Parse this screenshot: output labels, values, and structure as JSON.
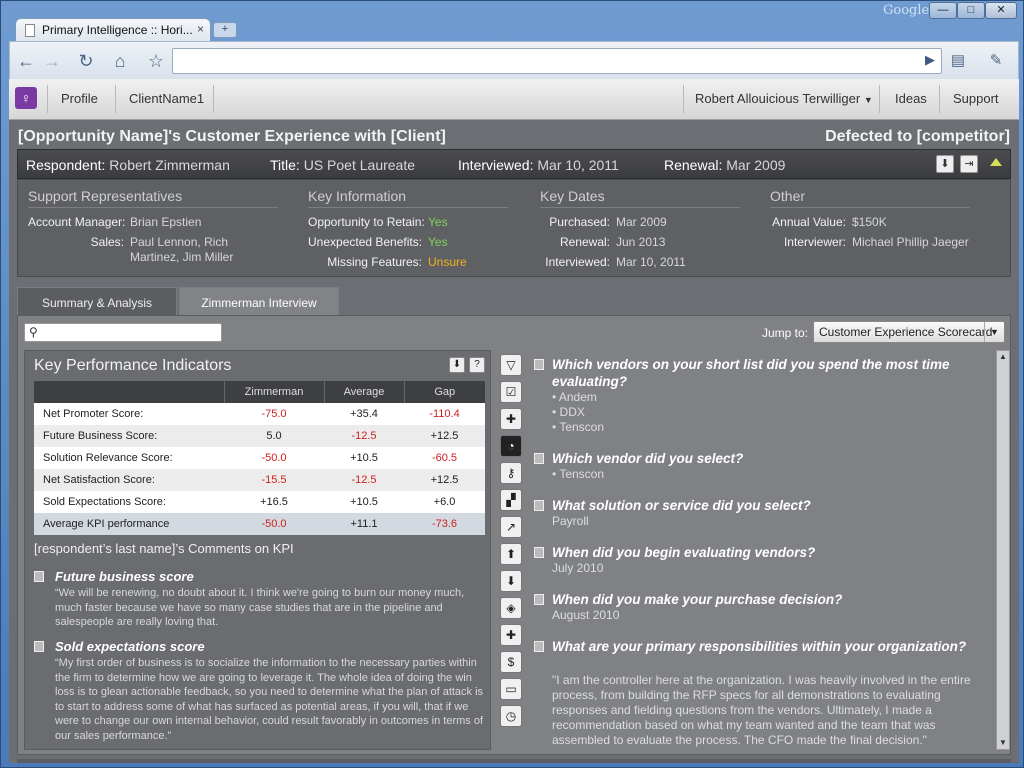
{
  "browser": {
    "tab_title": "Primary Intelligence :: Hori...",
    "tab_close": "×",
    "new_tab": "+",
    "brand": "Google",
    "minimize": "—",
    "maximize": "□",
    "close": "✕",
    "url": ""
  },
  "appnav": {
    "logo": "♀",
    "profile": "Profile",
    "client": "ClientName1",
    "user": "Robert Allouicious Terwilliger",
    "ideas": "Ideas",
    "support": "Support"
  },
  "header": {
    "title": "[Opportunity Name]'s Customer Experience with [Client]",
    "status": "Defected to [competitor]"
  },
  "respondent": {
    "name_label": "Respondent:",
    "name": "Robert Zimmerman",
    "title_label": "Title:",
    "title": "US Poet Laureate",
    "interviewed_label": "Interviewed:",
    "interviewed": "Mar 10, 2011",
    "renewal_label": "Renewal:",
    "renewal": "Mar 2009"
  },
  "info": {
    "support": {
      "heading": "Support Representatives",
      "rows": [
        {
          "k": "Account Manager:",
          "v": "Brian Epstien"
        },
        {
          "k": "Sales:",
          "v": "Paul Lennon, Rich"
        },
        {
          "k": "",
          "v": "Martinez, Jim Miller"
        }
      ]
    },
    "key": {
      "heading": "Key Information",
      "rows": [
        {
          "k": "Opportunity to Retain:",
          "v": "Yes"
        },
        {
          "k": "Unexpected Benefits:",
          "v": "Yes"
        },
        {
          "k": "Missing Features:",
          "v": "Unsure"
        }
      ]
    },
    "dates": {
      "heading": "Key Dates",
      "rows": [
        {
          "k": "Purchased:",
          "v": "Mar 2009"
        },
        {
          "k": "Renewal:",
          "v": "Jun  2013"
        },
        {
          "k": "Interviewed:",
          "v": "Mar 10, 2011"
        }
      ]
    },
    "other": {
      "heading": "Other",
      "rows": [
        {
          "k": "Annual Value:",
          "v": "$150K"
        },
        {
          "k": "Interviewer:",
          "v": "Michael Phillip Jaeger"
        }
      ]
    }
  },
  "tabs": {
    "summary": "Summary & Analysis",
    "interview": "Zimmerman Interview"
  },
  "toolbar": {
    "search_placeholder": "",
    "jump_label": "Jump to:",
    "jump_value": "Customer Experience Scorecard"
  },
  "kpi": {
    "title": "Key Performance Indicators",
    "download": "⬇",
    "help": "?",
    "headers": [
      "",
      "Zimmerman",
      "Average",
      "Gap"
    ],
    "rows": [
      [
        "Net Promoter Score:",
        "-75.0",
        "+35.4",
        "-110.4"
      ],
      [
        "Future Business Score:",
        "5.0",
        "-12.5",
        "+12.5"
      ],
      [
        "Solution Relevance Score:",
        "-50.0",
        "+10.5",
        "-60.5"
      ],
      [
        "Net Satisfaction Score:",
        "-15.5",
        "-12.5",
        "+12.5"
      ],
      [
        "Sold Expectations Score:",
        "+16.5",
        "+10.5",
        "+6.0"
      ],
      [
        "Average KPI performance",
        "-50.0",
        "+11.1",
        "-73.6"
      ]
    ],
    "comments_heading": "[respondent’s last name]’s Comments on KPI",
    "comments": [
      {
        "title": "Future business score",
        "text": "“We will be renewing, no doubt about it. I think we're going to burn our money much, much faster because we have so many case studies that are in the pipeline and salespeople are really loving that."
      },
      {
        "title": "Sold expectations score",
        "text": "“My first order of business is to socialize the information to the necessary parties within the firm to determine how we are going to leverage it. The whole idea of doing the win loss is to glean actionable feedback, so you need to determine what the plan of attack is to start to address some of what has surfaced as potential areas, if you will, that if we were to change our own internal behavior, could result favorably in outcomes in terms of our sales performance.”"
      }
    ]
  },
  "tools": [
    "▽",
    "☑",
    "✚",
    "◔",
    "⚷",
    "▞",
    "↗",
    "⬆",
    "⬇",
    "◈",
    "✚",
    "$",
    "▭",
    "◷"
  ],
  "interview": {
    "questions": [
      {
        "q": "Which vendors on your short list did you spend the most time evaluating?",
        "a": [
          "• Andem",
          "• DDX",
          "• Tenscon"
        ]
      },
      {
        "q": "Which vendor did you select?",
        "a": [
          "• Tenscon"
        ]
      },
      {
        "q": "What solution or service did you select?",
        "a": [
          "Payroll"
        ]
      },
      {
        "q": "When did you begin evaluating vendors?",
        "a": [
          "July 2010"
        ]
      },
      {
        "q": "When did you make your purchase decision?",
        "a": [
          "August 2010"
        ]
      },
      {
        "q": "What are your primary responsibilities within your organization?",
        "a": [
          "\"I am the controller here at the organization. I was heavily involved in the entire process, from building the RFP specs for all demonstrations to evaluating responses and fielding questions from the vendors. Ultimately, I made a recommendation based on what my team wanted and the team that was assembled to evaluate the process. The CFO made the final decision.\""
        ]
      }
    ]
  },
  "colors": {
    "negative": "#cc1f1f",
    "positive_flag": "#7fd35a",
    "warning_flag": "#f0b21e"
  }
}
